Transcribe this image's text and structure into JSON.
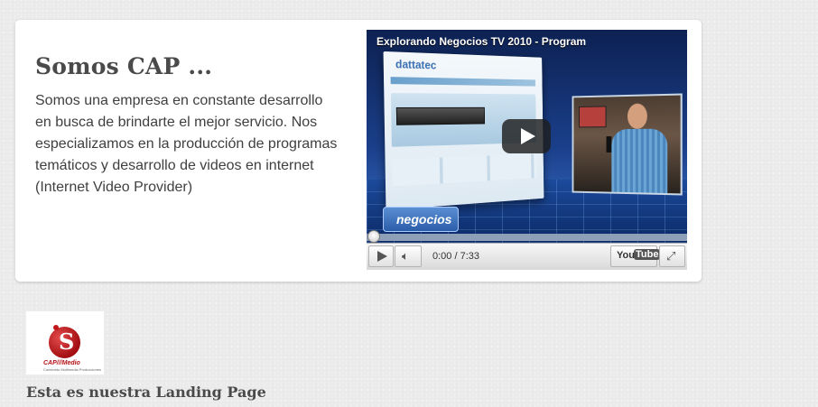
{
  "about": {
    "heading": "Somos CAP ...",
    "description": "Somos una empresa en constante desarrollo en busca de brindarte el mejor servicio. Nos especializamos en la producción de programas temáticos y desarrollo de videos en internet (Internet Video Provider)"
  },
  "video": {
    "title": "Explorando Negocios TV 2010 - Program",
    "site_brand": "dattatec",
    "overlay_logo": "negocios",
    "time_display": "0:00 / 7:33",
    "progress": 0,
    "youtube_you": "You",
    "youtube_tube": "Tube",
    "icons": {
      "play": "play-icon",
      "volume": "volume-icon",
      "fullscreen": "fullscreen-icon"
    },
    "colors": {
      "progress_fill": "#c41f1f",
      "background": "#0b1a3a"
    }
  },
  "logo": {
    "brand": "CAP///Medio",
    "tagline": "Contenido Multimedia Producciones"
  },
  "landing": {
    "text": "Esta es nuestra Landing Page"
  }
}
